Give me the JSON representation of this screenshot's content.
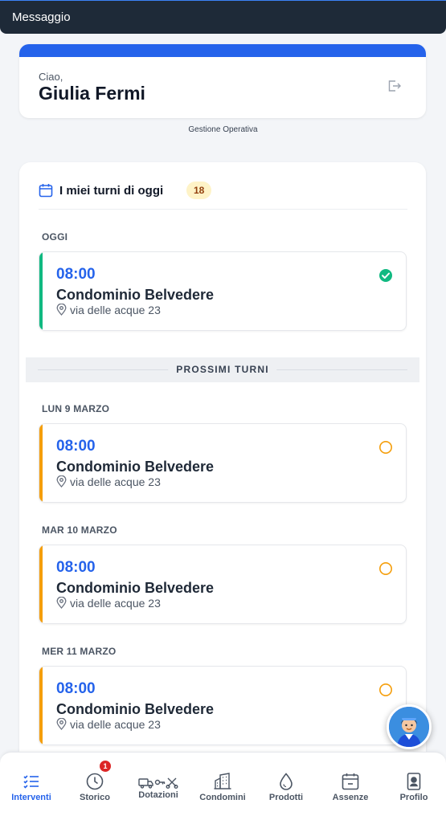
{
  "topbar": {
    "title": "Messaggio"
  },
  "welcome": {
    "greeting": "Ciao,",
    "name": "Giulia Fermi",
    "subtitle": "Gestione Operativa"
  },
  "shifts": {
    "title": "I miei turni di oggi",
    "count": "18",
    "today_label": "OGGI",
    "upcoming_label": "PROSSIMI TURNI",
    "groups": [
      {
        "day": "OGGI",
        "time": "08:00",
        "place": "Condominio Belvedere",
        "address": "via delle acque 23",
        "status": "completed",
        "accent": "#10b981"
      },
      {
        "day": "LUN 9 MARZO",
        "time": "08:00",
        "place": "Condominio Belvedere",
        "address": "via delle acque 23",
        "status": "pending",
        "accent": "#f59e0b"
      },
      {
        "day": "MAR 10 MARZO",
        "time": "08:00",
        "place": "Condominio Belvedere",
        "address": "via delle acque 23",
        "status": "pending",
        "accent": "#f59e0b"
      },
      {
        "day": "MER 11 MARZO",
        "time": "08:00",
        "place": "Condominio Belvedere",
        "address": "via delle acque 23",
        "status": "pending",
        "accent": "#f59e0b"
      }
    ]
  },
  "nav": {
    "items": [
      {
        "label": "Interventi",
        "icon": "list-icon",
        "active": true
      },
      {
        "label": "Storico",
        "icon": "clock-icon",
        "badge": "1"
      },
      {
        "label": "Dotazioni",
        "icon": "tools-icon"
      },
      {
        "label": "Condomini",
        "icon": "building-icon"
      },
      {
        "label": "Prodotti",
        "icon": "drop-icon"
      },
      {
        "label": "Assenze",
        "icon": "calendar-minus-icon"
      },
      {
        "label": "Profilo",
        "icon": "id-badge-icon"
      }
    ]
  },
  "colors": {
    "primary": "#2563eb",
    "success": "#10b981",
    "warning": "#f59e0b",
    "topbar": "#1e2a38"
  }
}
